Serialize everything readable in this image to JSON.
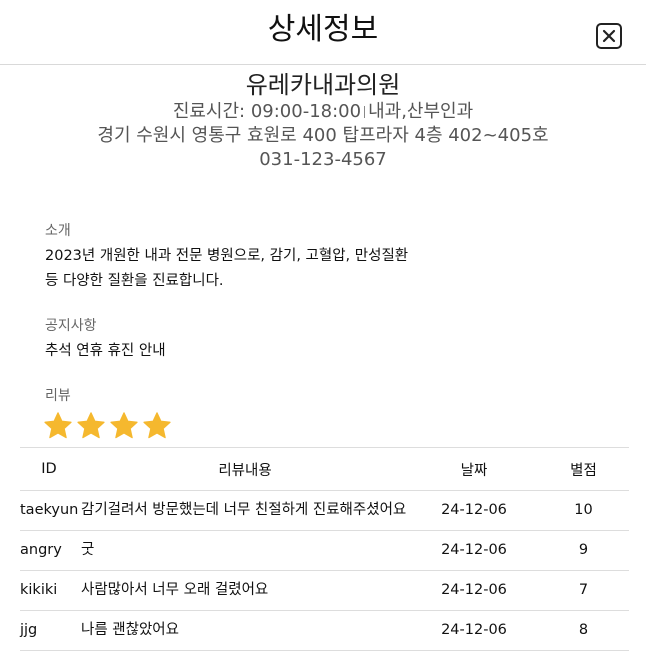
{
  "header": {
    "title": "상세정보"
  },
  "clinic": {
    "name": "유레카내과의원",
    "hours_label": "진료시간: 09:00-18:00",
    "departments": "내과,산부인과",
    "address": "경기 수원시 영통구 효원로 400 탑프라자 4층 402~405호",
    "phone": "031-123-4567"
  },
  "intro": {
    "label": "소개",
    "text_line1": "2023년 개원한 내과 전문 병원으로, 감기, 고혈압, 만성질환",
    "text_line2": "등 다양한 질환을 진료합니다."
  },
  "notice": {
    "label": "공지사항",
    "text": "추석 연휴 휴진 안내"
  },
  "reviews": {
    "label": "리뷰",
    "star_count": 4,
    "star_color": "#F5B82E",
    "columns": {
      "id": "ID",
      "content": "리뷰내용",
      "date": "날짜",
      "rating": "별점"
    },
    "rows": [
      {
        "id": "taekyun",
        "content": "감기걸려서 방문했는데 너무 친절하게 진료해주셨어요",
        "date": "24-12-06",
        "rating": "10"
      },
      {
        "id": "angry",
        "content": "굿",
        "date": "24-12-06",
        "rating": "9"
      },
      {
        "id": "kikiki",
        "content": "사람많아서 너무 오래 걸렸어요",
        "date": "24-12-06",
        "rating": "7"
      },
      {
        "id": "jjg",
        "content": "나름 괜찮았어요",
        "date": "24-12-06",
        "rating": "8"
      }
    ]
  }
}
